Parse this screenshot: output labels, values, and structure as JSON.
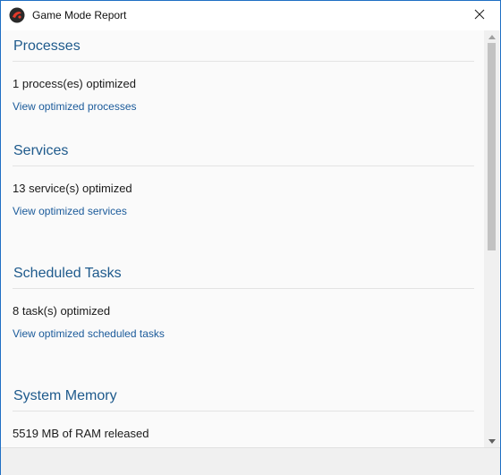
{
  "window": {
    "title": "Game Mode Report",
    "accent_color": "#1f6fc4",
    "app_icon": "game-mode-logo-icon",
    "close_icon": "close-icon"
  },
  "sections": [
    {
      "title": "Processes",
      "summary": "1 process(es) optimized",
      "link": "View optimized processes"
    },
    {
      "title": "Services",
      "summary": "13 service(s) optimized",
      "link": "View optimized services"
    },
    {
      "title": "Scheduled Tasks",
      "summary": "8 task(s) optimized",
      "link": "View optimized scheduled tasks"
    },
    {
      "title": "System Memory",
      "summary": "5519 MB of RAM released"
    }
  ],
  "colors": {
    "section_title": "#1e5a8c",
    "link": "#1a5a9a"
  }
}
